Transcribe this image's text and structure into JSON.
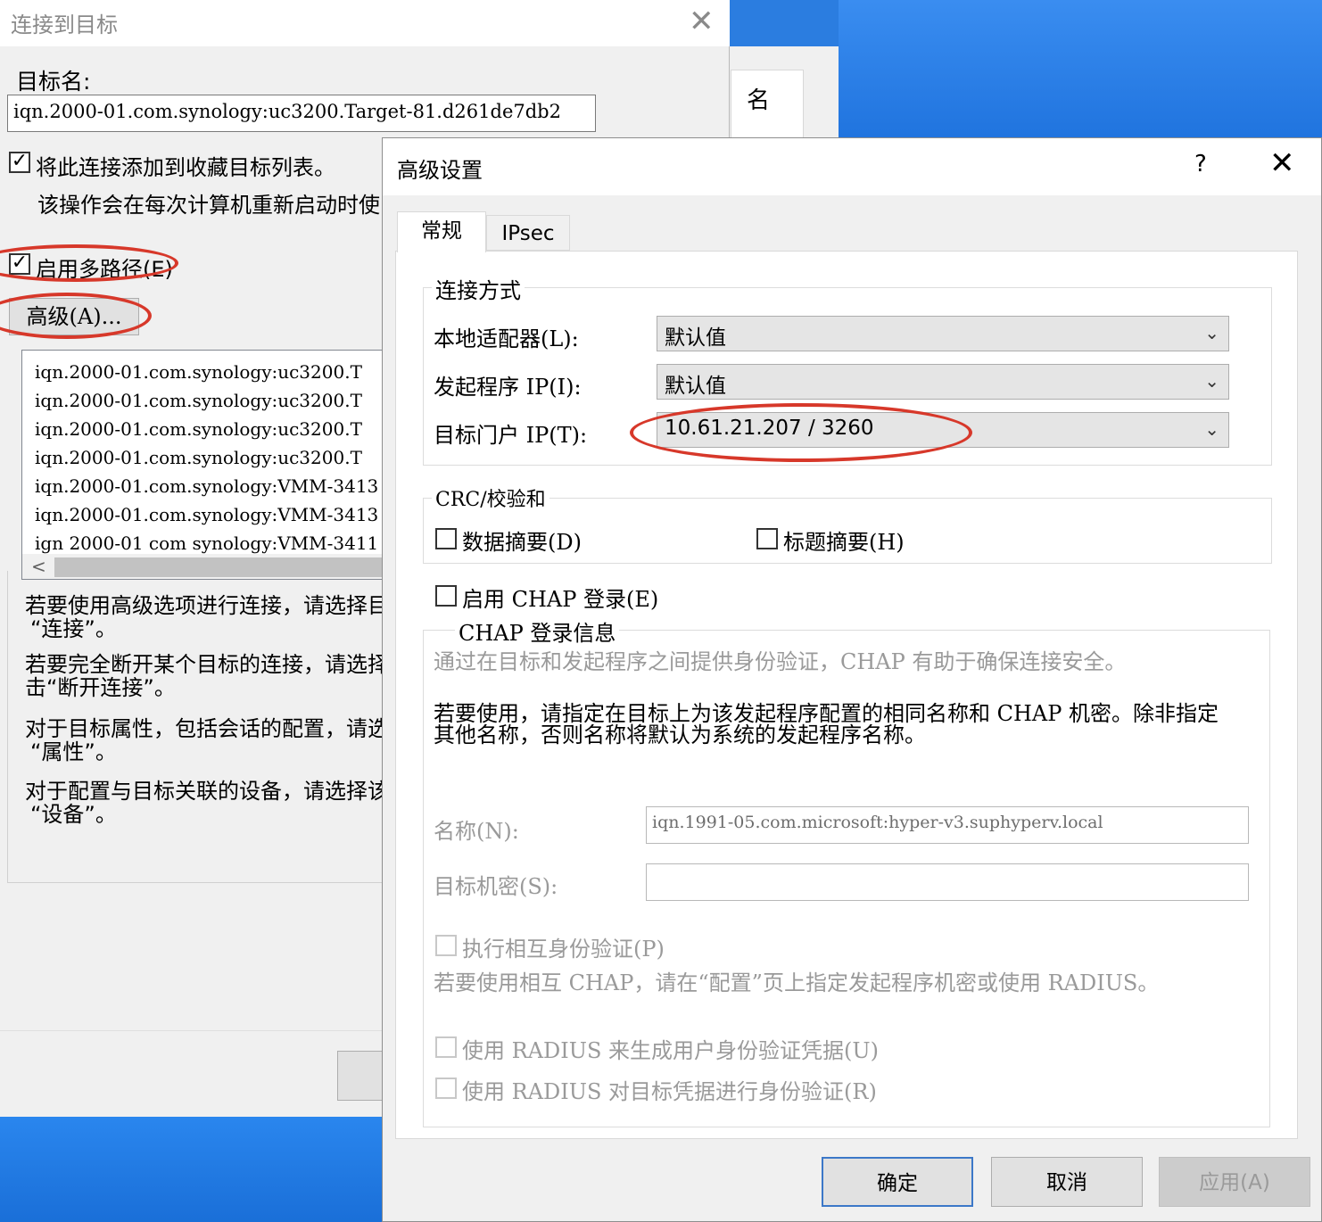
{
  "connect_dialog": {
    "title": "连接到目标",
    "target_name_label": "目标名:",
    "target_name_value": "iqn.2000-01.com.synology:uc3200.Target-81.d261de7db2",
    "favorite_checkbox_label": "将此连接添加到收藏目标列表。",
    "favorite_checkbox_checked": true,
    "favorite_desc": "该操作会在每次计算机重新启动时使",
    "multipath_label": "启用多路径(E)",
    "multipath_checked": true,
    "advanced_button": "高级(A)...",
    "target_list": [
      "iqn.2000-01.com.synology:uc3200.T",
      "iqn.2000-01.com.synology:uc3200.T",
      "iqn.2000-01.com.synology:uc3200.T",
      "iqn.2000-01.com.synology:uc3200.T",
      "iqn.2000-01.com.synology:VMM-3413",
      "iqn.2000-01.com.synology:VMM-3413",
      "ign 2000-01 com synology:VMM-3411"
    ],
    "help_1a": "若要使用高级选项进行连接，请选择目",
    "help_1b": "“连接”。",
    "help_2a": "若要完全断开某个目标的连接，请选择",
    "help_2b": "击“断开连接”。",
    "help_3a": "对于目标属性，包括会话的配置，请选",
    "help_3b": "“属性”。",
    "help_4a": "对于配置与目标关联的设备，请选择该",
    "help_4b": "“设备”。"
  },
  "background_window": {
    "label": "名"
  },
  "advanced_dialog": {
    "title": "高级设置",
    "help_icon": "?",
    "tabs": [
      {
        "label": "常规",
        "active": true
      },
      {
        "label": "IPsec",
        "active": false
      }
    ],
    "connect_by": {
      "group_title": "连接方式",
      "local_adapter_label": "本地适配器(L):",
      "local_adapter_value": "默认值",
      "initiator_ip_label": "发起程序 IP(I):",
      "initiator_ip_value": "默认值",
      "target_portal_label": "目标门户 IP(T):",
      "target_portal_value": "10.61.21.207 / 3260"
    },
    "crc": {
      "group_title": "CRC/校验和",
      "data_digest_label": "数据摘要(D)",
      "data_digest_checked": false,
      "header_digest_label": "标题摘要(H)",
      "header_digest_checked": false
    },
    "chap": {
      "enable_label": "启用 CHAP 登录(E)",
      "enable_checked": false,
      "group_title": "CHAP 登录信息",
      "desc": "通过在目标和发起程序之间提供身份验证，CHAP 有助于确保连接安全。",
      "note_line1": "若要使用，请指定在目标上为该发起程序配置的相同名称和 CHAP 机密。除非指定",
      "note_line2": "其他名称，否则名称将默认为系统的发起程序名称。",
      "name_label": "名称(N):",
      "name_value": "iqn.1991-05.com.microsoft:hyper-v3.suphyperv.local",
      "secret_label": "目标机密(S):",
      "secret_value": "",
      "mutual_label": "执行相互身份验证(P)",
      "mutual_desc": "若要使用相互 CHAP，请在“配置”页上指定发起程序机密或使用 RADIUS。",
      "radius_gen_label": "使用 RADIUS 来生成用户身份验证凭据(U)",
      "radius_auth_label": "使用 RADIUS 对目标凭据进行身份验证(R)"
    },
    "buttons": {
      "ok": "确定",
      "cancel": "取消",
      "apply": "应用(A)"
    }
  },
  "colors": {
    "annotation_ring": "#d7382a",
    "desktop": "#2b7de0",
    "ok_border": "#3c78c8"
  }
}
